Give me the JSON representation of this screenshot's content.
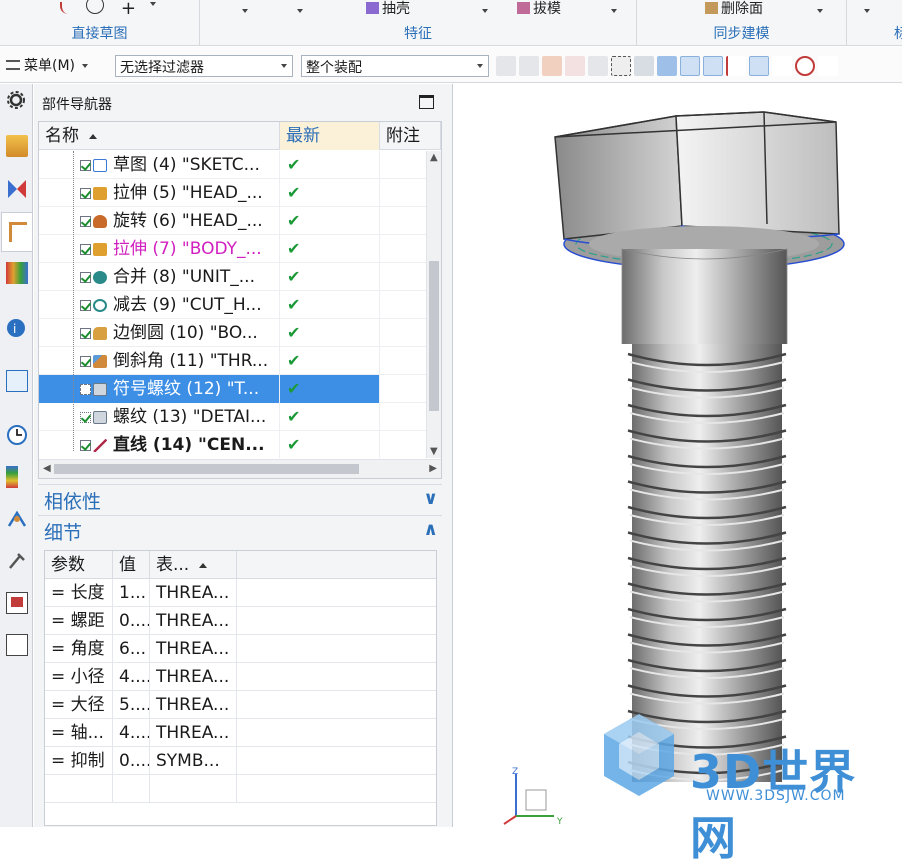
{
  "ribbon": {
    "groups": [
      {
        "label": "直接草图"
      },
      {
        "label": "特征"
      },
      {
        "label": "同步建模"
      },
      {
        "label": "标"
      }
    ],
    "commands": {
      "shell": "抽壳",
      "draft": "拔模",
      "delete_face": "删除面"
    }
  },
  "toolbar": {
    "menu_label": "菜单(M)",
    "filter_value": "无选择过滤器",
    "assembly_value": "整个装配"
  },
  "navigator": {
    "title": "部件导航器",
    "columns": {
      "name": "名称",
      "latest": "最新",
      "note": "附注"
    },
    "rows": [
      {
        "label": "草图 (4) \"SKETC...",
        "latest": "✔",
        "icon_color": "#3a7bd5",
        "icon": "sketch-icon"
      },
      {
        "label": "拉伸 (5) \"HEAD_...",
        "latest": "✔",
        "icon_color": "#e0a030",
        "icon": "extrude-icon"
      },
      {
        "label": "旋转 (6) \"HEAD_...",
        "latest": "✔",
        "icon_color": "#c86a2a",
        "icon": "revolve-icon"
      },
      {
        "label": "拉伸 (7) \"BODY_...",
        "latest": "✔",
        "icon_color": "#e0a030",
        "icon": "extrude-icon"
      },
      {
        "label": "合并 (8) \"UNIT_...",
        "latest": "✔",
        "icon_color": "#2a8a8a",
        "icon": "unite-icon"
      },
      {
        "label": "减去 (9) \"CUT_H...",
        "latest": "✔",
        "icon_color": "#2a8a8a",
        "icon": "subtract-icon"
      },
      {
        "label": "边倒圆 (10) \"BO...",
        "latest": "✔",
        "icon_color": "#d8a040",
        "icon": "edge-blend-icon"
      },
      {
        "label": "倒斜角 (11) \"THR...",
        "latest": "✔",
        "icon_color": "#d08a3a",
        "icon": "chamfer-icon"
      },
      {
        "label": "符号螺纹 (12) \"T...",
        "latest": "✔",
        "icon_color": "#7a8a9a",
        "icon": "symbolic-thread-icon"
      },
      {
        "label": "螺纹 (13) \"DETAI...",
        "latest": "✔",
        "icon_color": "#7a8a9a",
        "icon": "thread-icon"
      },
      {
        "label": "直线 (14) \"CEN...",
        "latest": "✔",
        "icon_color": "#b02a4a",
        "icon": "line-icon"
      }
    ]
  },
  "dependencies": {
    "title": "相依性"
  },
  "details": {
    "title": "细节",
    "columns": {
      "param": "参数",
      "value": "值",
      "expr": "表..."
    },
    "rows": [
      {
        "param": "= 长度",
        "value": "1...",
        "expr": "THREA..."
      },
      {
        "param": "= 螺距",
        "value": "0....",
        "expr": "THREA..."
      },
      {
        "param": "= 角度",
        "value": "6...",
        "expr": "THREA..."
      },
      {
        "param": "= 小径",
        "value": "4....",
        "expr": "THREA..."
      },
      {
        "param": "= 大径",
        "value": "5....",
        "expr": "THREA..."
      },
      {
        "param": "= 轴...",
        "value": "4....",
        "expr": "THREA..."
      },
      {
        "param": "= 抑制",
        "value": "0....",
        "expr": "SYMB..."
      }
    ]
  },
  "watermark": {
    "brand": "3D世界网",
    "url": "WWW.3DSJW.COM"
  },
  "triad": {
    "z": "Z",
    "y": "Y"
  },
  "colors": {
    "accent": "#2b6fb8",
    "selected": "#3d8fe6",
    "check": "#1c9a3a",
    "magenta": "#d11fbf"
  }
}
